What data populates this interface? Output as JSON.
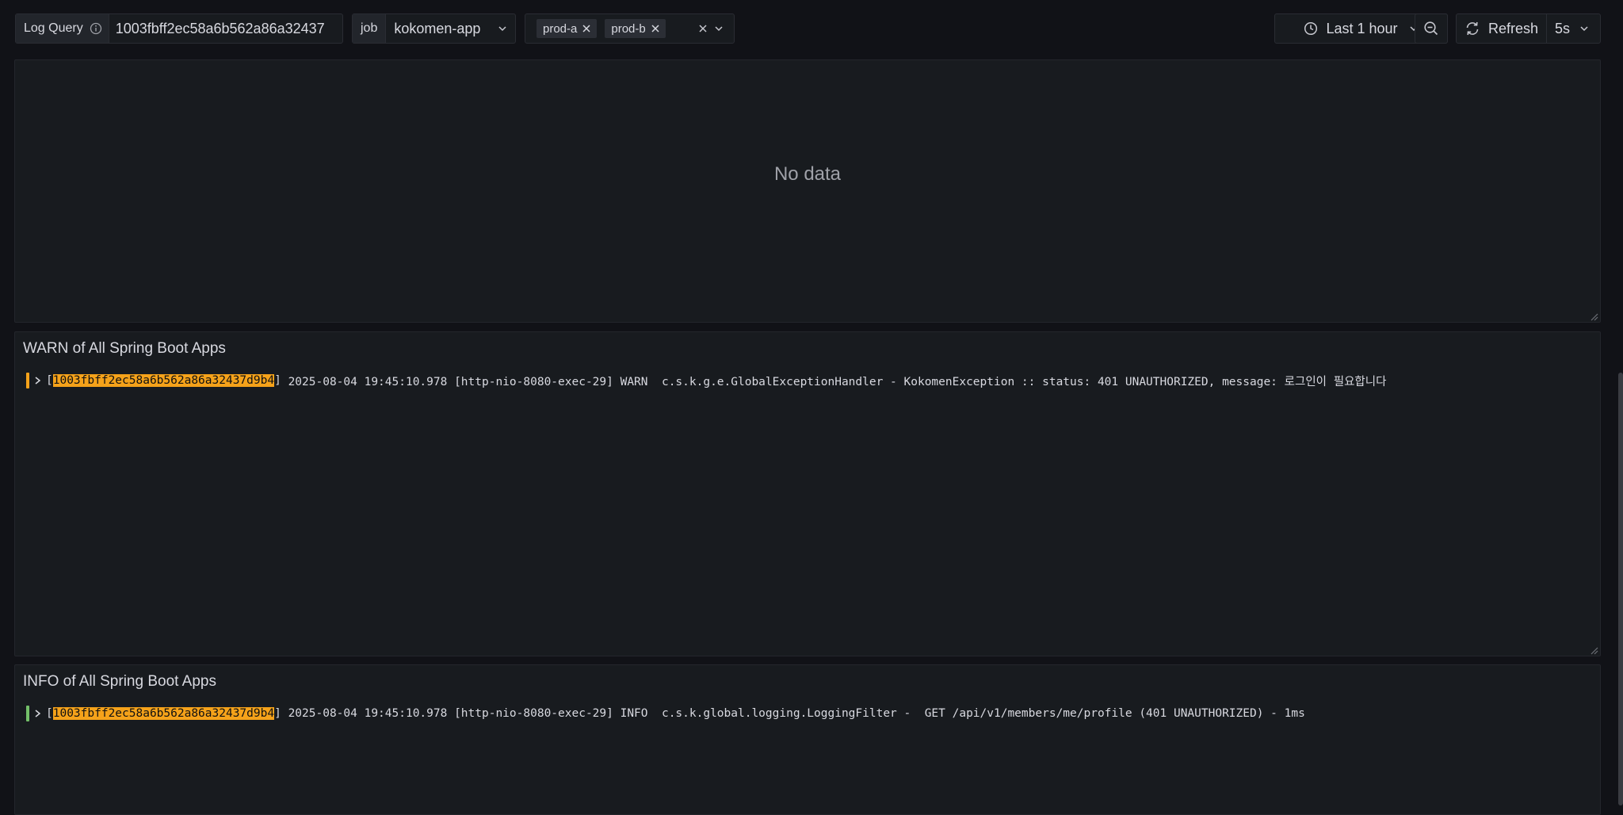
{
  "toolbar": {
    "log_query_label": "Log Query",
    "log_query_value": "1003fbff2ec58a6b562a86a32437",
    "job_label": "job",
    "job_value": "kokomen-app",
    "env_chips": [
      "prod-a",
      "prod-b"
    ],
    "time_range": "Last 1 hour",
    "refresh_label": "Refresh",
    "refresh_interval": "5s"
  },
  "panels": {
    "top": {
      "title": "",
      "empty_text": "No data"
    },
    "warn": {
      "title": "WARN of All Spring Boot Apps",
      "level_color": "#f5a21a",
      "lines": [
        {
          "trace": "1003fbff2ec58a6b562a86a32437d9b4",
          "text": "2025-08-04 19:45:10.978 [http-nio-8080-exec-29] WARN  c.s.k.g.e.GlobalExceptionHandler - KokomenException :: status: 401 UNAUTHORIZED, message: 로그인이 필요합니다"
        }
      ]
    },
    "info": {
      "title": "INFO of All Spring Boot Apps",
      "level_color": "#73bf69",
      "lines": [
        {
          "trace": "1003fbff2ec58a6b562a86a32437d9b4",
          "text": "2025-08-04 19:45:10.978 [http-nio-8080-exec-29] INFO  c.s.k.global.logging.LoggingFilter -  GET /api/v1/members/me/profile (401 UNAUTHORIZED) - 1ms"
        }
      ]
    }
  },
  "colors": {
    "background": "#111217",
    "panel": "#181b1f",
    "highlight": "#f5a21a"
  },
  "icons": [
    "info-icon",
    "chevron-down-icon",
    "close-icon",
    "clock-icon",
    "zoom-out-icon",
    "refresh-icon",
    "expand-row-icon",
    "resize-handle-icon"
  ]
}
